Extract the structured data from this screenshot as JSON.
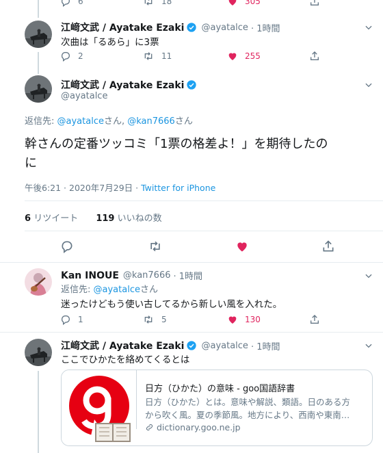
{
  "top_partial": {
    "reply_count": "6",
    "retweet_count": "18",
    "like_count": "305"
  },
  "tweet1": {
    "name": "江﨑文武 / Ayatake Ezaki",
    "handle": "@ayatalce",
    "time": "· 1時間",
    "text": "次曲は「るあら」に3票",
    "reply_count": "2",
    "retweet_count": "11",
    "like_count": "255"
  },
  "main": {
    "name": "江﨑文武 / Ayatake Ezaki",
    "handle": "@ayatalce",
    "reply_to_prefix": "返信先: ",
    "reply_to_user1": "@ayatalce",
    "reply_to_san1": "さん, ",
    "reply_to_user2": "@kan7666",
    "reply_to_san2": "さん",
    "text_line1": "幹さんの定番ツッコミ「1票の格差よ！」を期待したの",
    "text_line2": "に",
    "timestamp": "午後6:21 · 2020年7月29日 · ",
    "source": "Twitter for iPhone",
    "retweets_num": "6",
    "retweets_label": "リツイート",
    "likes_num": "119",
    "likes_label": "いいねの数"
  },
  "reply1": {
    "name": "Kan INOUE",
    "handle": "@kan7666",
    "time": "· 1時間",
    "reply_to_prefix": "返信先: ",
    "reply_to_user": "@ayatalce",
    "reply_to_san": "さん",
    "text": "迷ったけどもう使い古してるから新しい風を入れた。",
    "reply_count": "1",
    "retweet_count": "5",
    "like_count": "130"
  },
  "reply2": {
    "name": "江﨑文武 / Ayatake Ezaki",
    "handle": "@ayatalce",
    "time": "· 1時間",
    "text": "ここでひかたを絡めてくるとは",
    "card": {
      "title": "日方（ひかた）の意味 - goo国語辞書",
      "desc_line1": "日方（ひかた）とは。意味や解説、類語。日のある方",
      "desc_line2": "から吹く風。夏の季節風。地方により、西南や東南…",
      "domain": "dictionary.goo.ne.jp"
    }
  },
  "colors": {
    "accent": "#1da1f2",
    "like": "#e0245e",
    "muted": "#657786",
    "goo_red": "#e60012"
  }
}
